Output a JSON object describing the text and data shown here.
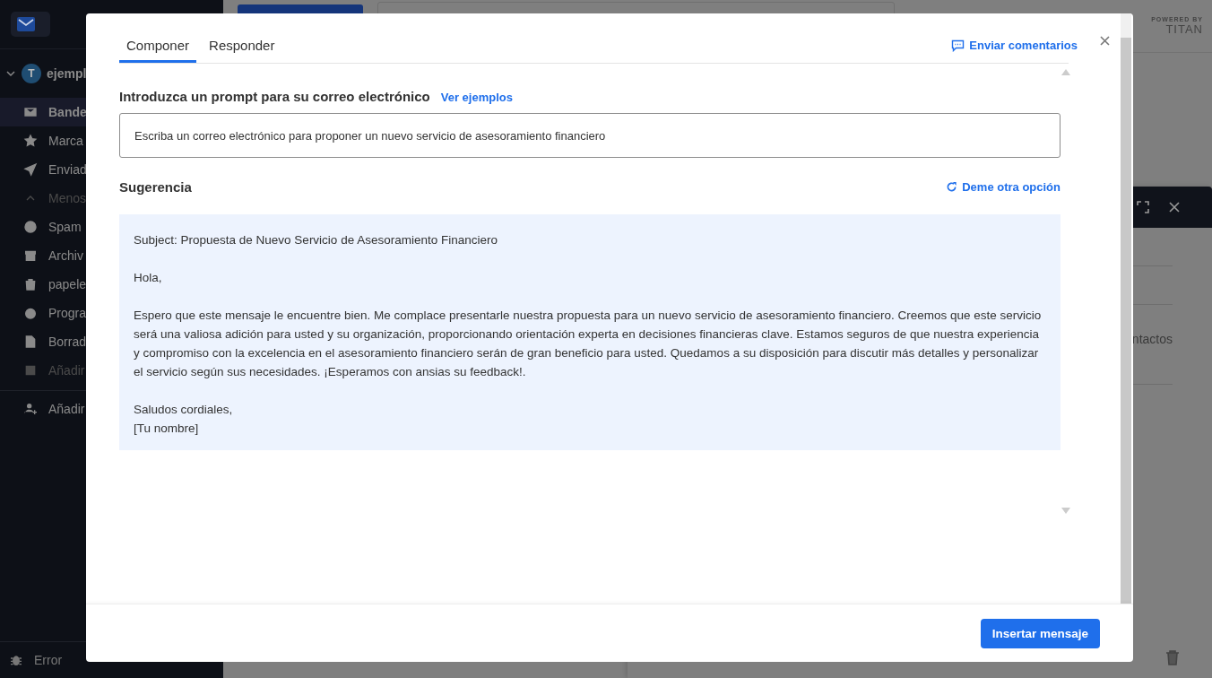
{
  "app": {
    "account": {
      "avatar": "T",
      "name": "ejempl"
    },
    "folders": [
      {
        "label": "Bande",
        "selected": true,
        "muted": false
      },
      {
        "label": "Marca",
        "selected": false,
        "muted": false
      },
      {
        "label": "Enviad",
        "selected": false,
        "muted": false
      },
      {
        "label": "Menos",
        "selected": false,
        "muted": true
      },
      {
        "label": "Spam",
        "selected": false,
        "muted": false
      },
      {
        "label": "Archiv",
        "selected": false,
        "muted": false
      },
      {
        "label": "papele",
        "selected": false,
        "muted": false
      },
      {
        "label": "Progra",
        "selected": false,
        "muted": false
      },
      {
        "label": "Borrad",
        "selected": false,
        "muted": false
      },
      {
        "label": "Añadir",
        "selected": false,
        "muted": true
      }
    ],
    "add_account": {
      "label": "Añadir"
    },
    "footer": {
      "label": "Error"
    },
    "background_text": "ntactos",
    "branding": {
      "caption": "POWERED BY",
      "name": "TITAN"
    }
  },
  "modal": {
    "tabs": [
      {
        "label": "Componer",
        "selected": true
      },
      {
        "label": "Responder",
        "selected": false
      }
    ],
    "feedback_link": "Enviar comentarios",
    "prompt_label": "Introduzca un prompt para su correo electrónico",
    "examples_link": "Ver ejemplos",
    "prompt_field": {
      "value": "Escriba un correo electrónico para proponer un nuevo servicio de asesoramiento financiero"
    },
    "suggestion_title": "Sugerencia",
    "regenerate_link": "Deme otra opción",
    "suggestion": [
      [
        "Subject: Propuesta de Nuevo Servicio de Asesoramiento Financiero"
      ],
      [
        "Hola,"
      ],
      [
        "Espero que este mensaje le encuentre bien. Me complace presentarle nuestra propuesta para un nuevo servicio de asesoramiento financiero. Creemos que este servicio será una valiosa adición para usted y su organización, proporcionando orientación experta en decisiones financieras clave. Estamos seguros de que nuestra experiencia y compromiso con la excelencia en el asesoramiento financiero serán de gran beneficio para usted. Quedamos a su disposición para discutir más detalles y personalizar el servicio según sus necesidades. ¡Esperamos con ansias su feedback!."
      ],
      [
        "Saludos cordiales,",
        "[Tu nombre]"
      ]
    ],
    "insert_button": "Insertar mensaje"
  }
}
